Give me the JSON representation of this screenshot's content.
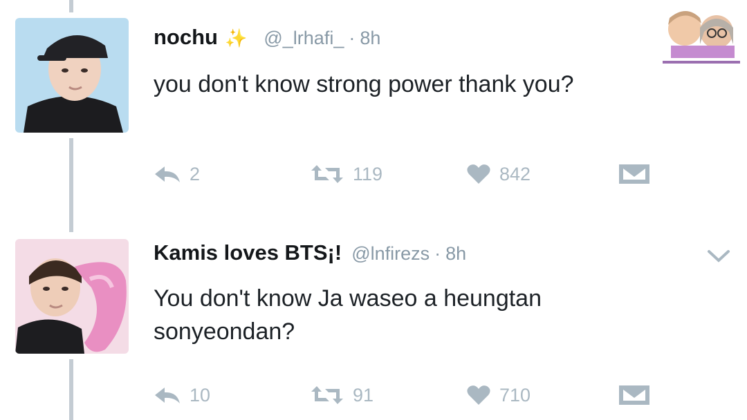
{
  "tweets": [
    {
      "display_name": "nochu",
      "badge_icon": "sparkles-icon",
      "handle": "@_lrhafi_",
      "separator": "·",
      "time": "8h",
      "text": "you don't know strong power thank you?",
      "replies": "2",
      "retweets": "119",
      "likes": "842"
    },
    {
      "display_name": "Kamis loves BTS¡!",
      "handle": "@lnfirezs",
      "separator": "·",
      "time": "8h",
      "text": "You don't know Ja waseo a heungtan sonyeondan?",
      "replies": "10",
      "retweets": "91",
      "likes": "710"
    }
  ],
  "icons": {
    "reply": "reply-icon",
    "retweet": "retweet-icon",
    "like": "heart-icon",
    "message": "envelope-icon",
    "more": "chevron-down-icon"
  },
  "colors": {
    "muted": "#aab8c2",
    "secondary_text": "#8899a6",
    "thread_line": "#c4ccd3",
    "avatar_bg": "#b9dcf0",
    "sparkle": "#f3c623"
  }
}
